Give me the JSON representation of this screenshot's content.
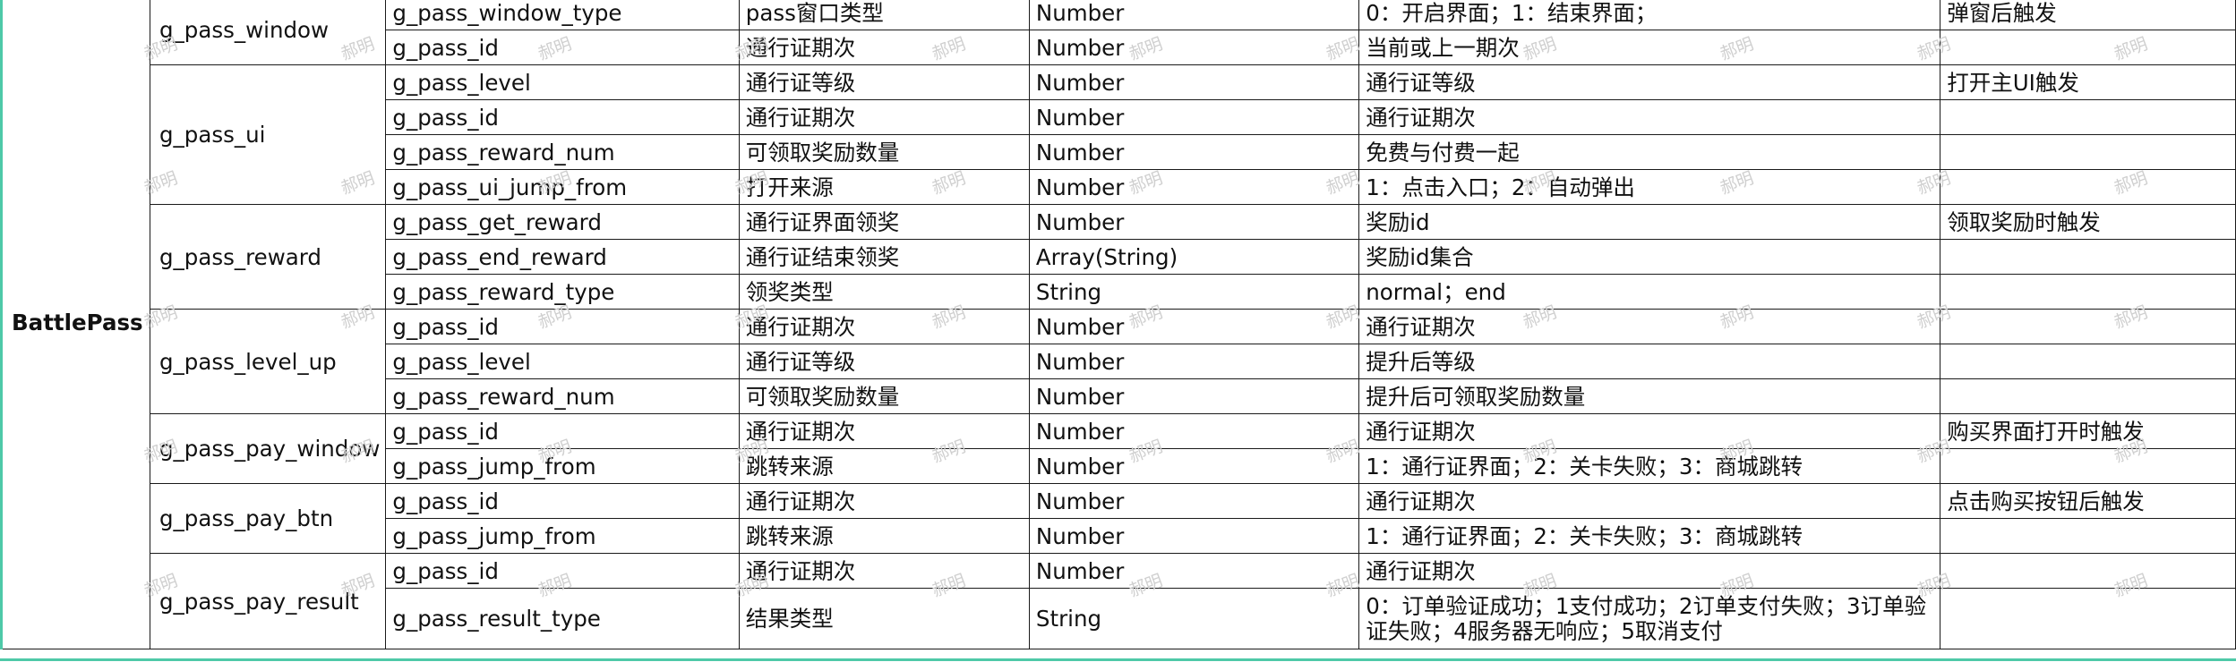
{
  "category": "BattlePass",
  "groups": [
    {
      "event": "g_pass_window",
      "rows": [
        {
          "param": "g_pass_window_type",
          "desc": "pass窗口类型",
          "type": "Number",
          "values": "0：开启界面；1：结束界面；",
          "note": "弹窗后触发"
        },
        {
          "param": "g_pass_id",
          "desc": "通行证期次",
          "type": "Number",
          "values": "当前或上一期次",
          "note": ""
        }
      ]
    },
    {
      "event": "g_pass_ui",
      "rows": [
        {
          "param": "g_pass_level",
          "desc": "通行证等级",
          "type": "Number",
          "values": "通行证等级",
          "note": "打开主UI触发"
        },
        {
          "param": "g_pass_id",
          "desc": "通行证期次",
          "type": "Number",
          "values": "通行证期次",
          "note": ""
        },
        {
          "param": "g_pass_reward_num",
          "desc": "可领取奖励数量",
          "type": "Number",
          "values": "免费与付费一起",
          "note": ""
        },
        {
          "param": "g_pass_ui_jump_from",
          "desc": "打开来源",
          "type": "Number",
          "values": "1：点击入口；2：自动弹出",
          "note": ""
        }
      ]
    },
    {
      "event": "g_pass_reward",
      "rows": [
        {
          "param": "g_pass_get_reward",
          "desc": "通行证界面领奖",
          "type": "Number",
          "values": "奖励id",
          "note": "领取奖励时触发"
        },
        {
          "param": "g_pass_end_reward",
          "desc": "通行证结束领奖",
          "type": "Array(String)",
          "values": "奖励id集合",
          "note": ""
        },
        {
          "param": "g_pass_reward_type",
          "desc": "领奖类型",
          "type": "String",
          "values": "normal；end",
          "note": ""
        }
      ]
    },
    {
      "event": "g_pass_level_up",
      "rows": [
        {
          "param": "g_pass_id",
          "desc": "通行证期次",
          "type": "Number",
          "values": "通行证期次",
          "note": ""
        },
        {
          "param": "g_pass_level",
          "desc": "通行证等级",
          "type": "Number",
          "values": "提升后等级",
          "note": ""
        },
        {
          "param": "g_pass_reward_num",
          "desc": "可领取奖励数量",
          "type": "Number",
          "values": "提升后可领取奖励数量",
          "note": ""
        }
      ]
    },
    {
      "event": "g_pass_pay_window",
      "rows": [
        {
          "param": "g_pass_id",
          "desc": "通行证期次",
          "type": "Number",
          "values": "通行证期次",
          "note": "购买界面打开时触发"
        },
        {
          "param": "g_pass_jump_from",
          "desc": "跳转来源",
          "type": "Number",
          "values": "1：通行证界面；2：关卡失败；3：商城跳转",
          "note": ""
        }
      ]
    },
    {
      "event": "g_pass_pay_btn",
      "rows": [
        {
          "param": "g_pass_id",
          "desc": "通行证期次",
          "type": "Number",
          "values": "通行证期次",
          "note": "点击购买按钮后触发"
        },
        {
          "param": "g_pass_jump_from",
          "desc": "跳转来源",
          "type": "Number",
          "values": "1：通行证界面；2：关卡失败；3：商城跳转",
          "note": ""
        }
      ]
    },
    {
      "event": "g_pass_pay_result",
      "rows": [
        {
          "param": "g_pass_id",
          "desc": "通行证期次",
          "type": "Number",
          "values": "通行证期次",
          "note": ""
        },
        {
          "param": "g_pass_result_type",
          "desc": "结果类型",
          "type": "String",
          "values": "0：订单验证成功；1支付成功；2订单支付失败；3订单验证失败；4服务器无响应；5取消支付",
          "note": ""
        }
      ]
    }
  ],
  "watermark_text": "郝明",
  "colors": {
    "grid": "#1a1a1a",
    "accent": "#4ec9a8",
    "watermark": "#cfcfcf"
  }
}
